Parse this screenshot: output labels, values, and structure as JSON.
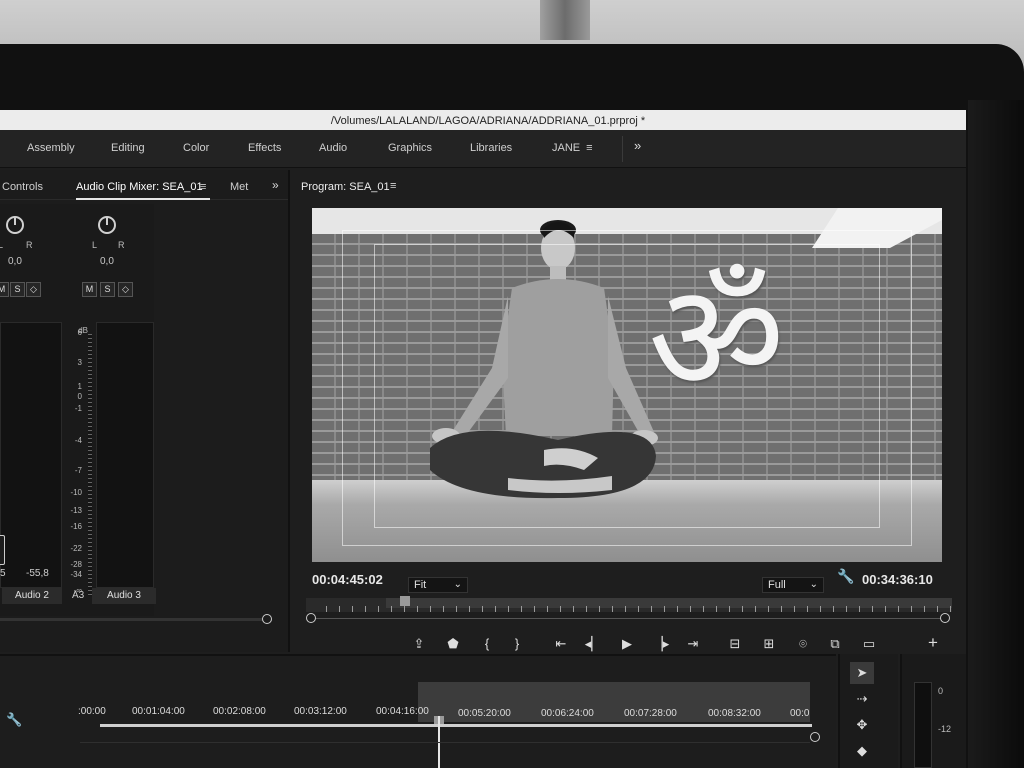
{
  "window": {
    "title": "/Volumes/LALALAND/LAGOA/ADRIANA/ADDRIANA_01.prproj *"
  },
  "workspaces": [
    {
      "label": "Assembly"
    },
    {
      "label": "Editing"
    },
    {
      "label": "Color"
    },
    {
      "label": "Effects"
    },
    {
      "label": "Audio"
    },
    {
      "label": "Graphics"
    },
    {
      "label": "Libraries"
    },
    {
      "label": "JANE"
    }
  ],
  "icons": {
    "menu": "≡",
    "more": "»",
    "wrench": "🔧"
  },
  "left_panel": {
    "tabs": [
      {
        "label": "Controls"
      },
      {
        "label": "Audio Clip Mixer: SEA_01"
      },
      {
        "label": "Met"
      }
    ],
    "channels": [
      {
        "pan_l": "L",
        "pan_r": "R",
        "pan_value": "0,0",
        "buttons": [
          "M",
          "S",
          "◇"
        ],
        "level": "-55,8",
        "track_label": "Audio 2"
      },
      {
        "pan_l": "L",
        "pan_r": "R",
        "pan_value": "0,0",
        "buttons": [
          "M",
          "S",
          "◇"
        ],
        "track_label": "Audio 3",
        "track_id": "A3"
      }
    ],
    "left_edge_value": "5",
    "db_label": "dB",
    "db_scale": [
      "6",
      "3",
      "1",
      "0",
      "-1",
      "-4",
      "-7",
      "-10",
      "-13",
      "-16",
      "-22",
      "-28",
      "-34",
      "-∞"
    ]
  },
  "program_monitor": {
    "tab_label": "Program: SEA_01",
    "timecode_current": "00:04:45:02",
    "timecode_duration": "00:34:36:10",
    "zoom": {
      "value": "Fit"
    },
    "resolution": {
      "value": "Full"
    },
    "video_symbol": "ॐ"
  },
  "transport": [
    {
      "name": "export-frame",
      "glyph": "⇪"
    },
    {
      "name": "add-marker",
      "glyph": "⬟"
    },
    {
      "name": "mark-in",
      "glyph": "{"
    },
    {
      "name": "mark-out",
      "glyph": "}"
    },
    {
      "name": "go-to-in",
      "glyph": "⇤"
    },
    {
      "name": "step-back",
      "glyph": "◂▏"
    },
    {
      "name": "play",
      "glyph": "▶"
    },
    {
      "name": "step-forward",
      "glyph": "▕▸"
    },
    {
      "name": "go-to-out",
      "glyph": "⇥"
    },
    {
      "name": "insert",
      "glyph": "⊟"
    },
    {
      "name": "overwrite",
      "glyph": "⊞"
    },
    {
      "name": "export-frame-camera",
      "glyph": "⌾"
    },
    {
      "name": "comparison-view",
      "glyph": "⧉"
    },
    {
      "name": "safe-margins",
      "glyph": "▭"
    },
    {
      "name": "button-editor",
      "glyph": "+"
    }
  ],
  "timeline": {
    "ruler_labels": [
      ":00:00",
      "00:01:04:00",
      "00:02:08:00",
      "00:03:12:00",
      "00:04:16:00",
      "00:05:20:00",
      "00:06:24:00",
      "00:07:28:00",
      "00:08:32:00",
      "00:0"
    ]
  },
  "tools": [
    {
      "name": "selection",
      "glyph": "➤"
    },
    {
      "name": "track-select",
      "glyph": "⇢"
    },
    {
      "name": "ripple-edit",
      "glyph": "✥"
    },
    {
      "name": "razor",
      "glyph": "◆"
    }
  ],
  "audio_meters": {
    "scale": [
      "0",
      "-12"
    ]
  },
  "colors": {
    "panel_bg": "#1e1e1e",
    "title_bar": "#ececec",
    "accent_text": "#e8e8e8"
  }
}
